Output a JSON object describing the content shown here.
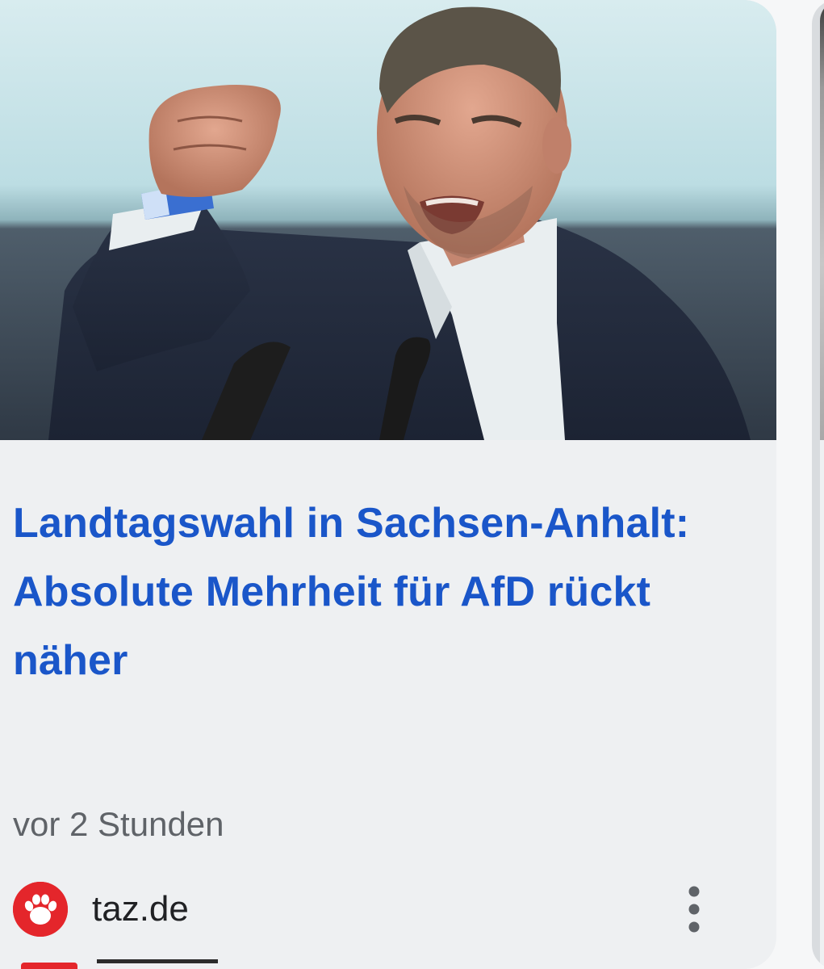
{
  "card": {
    "image_alt": "",
    "headline": "Landtagswahl in Sachsen-Anhalt: Absolute Mehrheit für AfD rückt näher",
    "timestamp": "vor 2 Stunden",
    "source": {
      "name": "taz.de",
      "logo_icon": "taz-paw-logo-icon",
      "logo_color": "#e4262b"
    },
    "more_icon": "more-vert-icon"
  },
  "colors": {
    "headline": "#1a56c9",
    "timestamp": "#5f6368",
    "source_text": "#202124",
    "card_background": "#eef0f2"
  }
}
